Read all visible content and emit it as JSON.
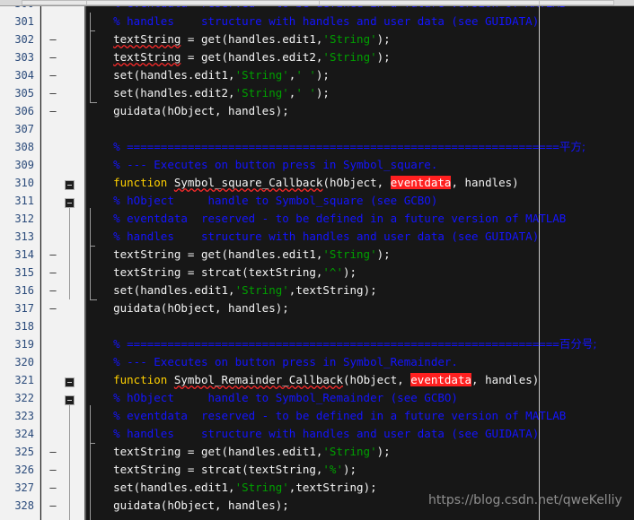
{
  "editor": {
    "app": "MATLAB Editor",
    "colors": {
      "background": "#171717",
      "gutter_background": "#f2f2f2",
      "line_number": "#2a4a7a",
      "comment": "#1414ff",
      "string": "#00a000",
      "keyword": "#ffd000",
      "plain_text": "#f0f0f0",
      "highlight_background": "#ff2020",
      "squiggly_underline": "#ff2a2a"
    },
    "first_line_number": 300,
    "last_line_number": 328,
    "watermark": "https://blog.csdn.net/qweKelliy",
    "lines": [
      {
        "n": 300,
        "dash": false,
        "tokens": [
          {
            "t": "% eventdata  reserved - to be defined in a future version of MATLAB",
            "c": "cm"
          }
        ]
      },
      {
        "n": 301,
        "dash": false,
        "tokens": [
          {
            "t": "% handles    structure with handles and user data (see GUIDATA)",
            "c": "cm"
          }
        ]
      },
      {
        "n": 302,
        "dash": true,
        "tokens": [
          {
            "t": "textString",
            "c": "pl sq"
          },
          {
            "t": " = get(handles.edit1,",
            "c": "pl"
          },
          {
            "t": "'String'",
            "c": "st"
          },
          {
            "t": ");",
            "c": "pl"
          }
        ]
      },
      {
        "n": 303,
        "dash": true,
        "tokens": [
          {
            "t": "textString",
            "c": "pl sq"
          },
          {
            "t": " = get(handles.edit2,",
            "c": "pl"
          },
          {
            "t": "'String'",
            "c": "st"
          },
          {
            "t": ");",
            "c": "pl"
          }
        ]
      },
      {
        "n": 304,
        "dash": true,
        "tokens": [
          {
            "t": "set(handles.edit1,",
            "c": "pl"
          },
          {
            "t": "'String'",
            "c": "st"
          },
          {
            "t": ",",
            "c": "pl"
          },
          {
            "t": "' '",
            "c": "st"
          },
          {
            "t": ");",
            "c": "pl"
          }
        ]
      },
      {
        "n": 305,
        "dash": true,
        "tokens": [
          {
            "t": "set(handles.edit2,",
            "c": "pl"
          },
          {
            "t": "'String'",
            "c": "st"
          },
          {
            "t": ",",
            "c": "pl"
          },
          {
            "t": "' '",
            "c": "st"
          },
          {
            "t": ");",
            "c": "pl"
          }
        ]
      },
      {
        "n": 306,
        "dash": true,
        "tokens": [
          {
            "t": "guidata(hObject, handles);",
            "c": "pl"
          }
        ]
      },
      {
        "n": 307,
        "dash": false,
        "tokens": []
      },
      {
        "n": 308,
        "dash": false,
        "tokens": [
          {
            "t": "% ================================================================",
            "c": "cm"
          },
          {
            "t": "平方;",
            "c": "cjk"
          }
        ]
      },
      {
        "n": 309,
        "dash": false,
        "tokens": [
          {
            "t": "% --- Executes on button press in Symbol_square.",
            "c": "cm"
          }
        ]
      },
      {
        "n": 310,
        "dash": false,
        "tokens": [
          {
            "t": "function",
            "c": "kw"
          },
          {
            "t": " ",
            "c": "pl"
          },
          {
            "t": "Symbol_square_Callback",
            "c": "pl sq"
          },
          {
            "t": "(hObject, ",
            "c": "pl"
          },
          {
            "t": "eventdata",
            "c": "hl"
          },
          {
            "t": ", handles)",
            "c": "pl"
          }
        ]
      },
      {
        "n": 311,
        "dash": false,
        "tokens": [
          {
            "t": "% hObject     handle to Symbol_square (see GCBO)",
            "c": "cm"
          }
        ]
      },
      {
        "n": 312,
        "dash": false,
        "tokens": [
          {
            "t": "% eventdata  reserved - to be defined in a future version of MATLAB",
            "c": "cm"
          }
        ]
      },
      {
        "n": 313,
        "dash": false,
        "tokens": [
          {
            "t": "% handles    structure with handles and user data (see GUIDATA)",
            "c": "cm"
          }
        ]
      },
      {
        "n": 314,
        "dash": true,
        "tokens": [
          {
            "t": "textString = get(handles.edit1,",
            "c": "pl"
          },
          {
            "t": "'String'",
            "c": "st"
          },
          {
            "t": ");",
            "c": "pl"
          }
        ]
      },
      {
        "n": 315,
        "dash": true,
        "tokens": [
          {
            "t": "textString = strcat(textString,",
            "c": "pl"
          },
          {
            "t": "'^'",
            "c": "st"
          },
          {
            "t": ");",
            "c": "pl"
          }
        ]
      },
      {
        "n": 316,
        "dash": true,
        "tokens": [
          {
            "t": "set(handles.edit1,",
            "c": "pl"
          },
          {
            "t": "'String'",
            "c": "st"
          },
          {
            "t": ",textString);",
            "c": "pl"
          }
        ]
      },
      {
        "n": 317,
        "dash": true,
        "tokens": [
          {
            "t": "guidata(hObject, handles);",
            "c": "pl"
          }
        ]
      },
      {
        "n": 318,
        "dash": false,
        "tokens": []
      },
      {
        "n": 319,
        "dash": false,
        "tokens": [
          {
            "t": "% ================================================================",
            "c": "cm"
          },
          {
            "t": "百分号;",
            "c": "cjk"
          }
        ]
      },
      {
        "n": 320,
        "dash": false,
        "tokens": [
          {
            "t": "% --- Executes on button press in Symbol_Remainder.",
            "c": "cm"
          }
        ]
      },
      {
        "n": 321,
        "dash": false,
        "tokens": [
          {
            "t": "function",
            "c": "kw"
          },
          {
            "t": " ",
            "c": "pl"
          },
          {
            "t": "Symbol_Remainder_Callback",
            "c": "pl sq"
          },
          {
            "t": "(hObject, ",
            "c": "pl"
          },
          {
            "t": "eventdata",
            "c": "hl"
          },
          {
            "t": ", handles)",
            "c": "pl"
          }
        ]
      },
      {
        "n": 322,
        "dash": false,
        "tokens": [
          {
            "t": "% hObject     handle to Symbol_Remainder (see GCBO)",
            "c": "cm"
          }
        ]
      },
      {
        "n": 323,
        "dash": false,
        "tokens": [
          {
            "t": "% eventdata  reserved - to be defined in a future version of MATLAB",
            "c": "cm"
          }
        ]
      },
      {
        "n": 324,
        "dash": false,
        "tokens": [
          {
            "t": "% handles    structure with handles and user data (see GUIDATA)",
            "c": "cm"
          }
        ]
      },
      {
        "n": 325,
        "dash": true,
        "tokens": [
          {
            "t": "textString = get(handles.edit1,",
            "c": "pl"
          },
          {
            "t": "'String'",
            "c": "st"
          },
          {
            "t": ");",
            "c": "pl"
          }
        ]
      },
      {
        "n": 326,
        "dash": true,
        "tokens": [
          {
            "t": "textString = strcat(textString,",
            "c": "pl"
          },
          {
            "t": "'%'",
            "c": "st"
          },
          {
            "t": ");",
            "c": "pl"
          }
        ]
      },
      {
        "n": 327,
        "dash": true,
        "tokens": [
          {
            "t": "set(handles.edit1,",
            "c": "pl"
          },
          {
            "t": "'String'",
            "c": "st"
          },
          {
            "t": ",textString);",
            "c": "pl"
          }
        ]
      },
      {
        "n": 328,
        "dash": true,
        "tokens": [
          {
            "t": "guidata(hObject, handles);",
            "c": "pl"
          }
        ]
      }
    ],
    "fold_markers": [
      {
        "line": 310,
        "type": "collapse-box"
      },
      {
        "line": 311,
        "type": "collapse-box"
      }
    ]
  }
}
